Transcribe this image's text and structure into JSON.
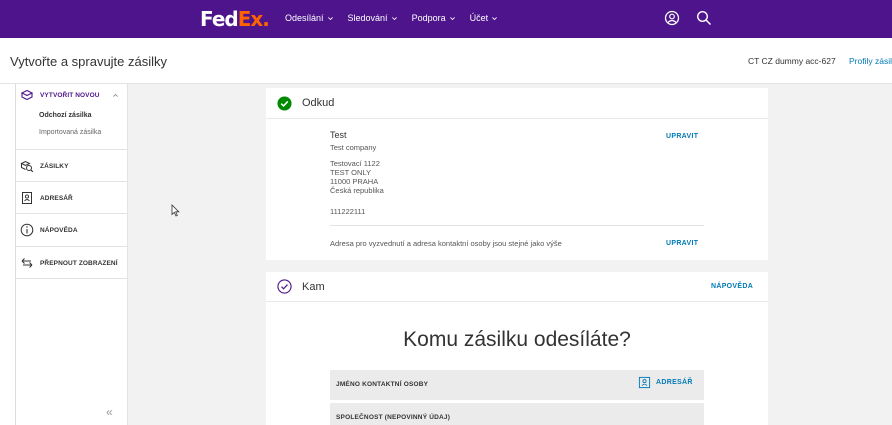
{
  "brand": {
    "logo_fed": "Fed",
    "logo_ex": "Ex.",
    "purple": "#4d148c",
    "orange": "#ff6200",
    "link_blue": "#007ab7"
  },
  "nav": {
    "items": [
      {
        "label": "Odesílání"
      },
      {
        "label": "Sledování"
      },
      {
        "label": "Podpora"
      },
      {
        "label": "Účet"
      }
    ],
    "icons": [
      "account-icon",
      "search-icon"
    ]
  },
  "header": {
    "title": "Vytvořte a spravujte zásilky",
    "account": "CT CZ dummy acc-627",
    "profiles_link": "Profily zásil"
  },
  "sidebar": {
    "create_new": "VYTVOŘIT NOVOU",
    "sub_outgoing": "Odchozí zásilka",
    "sub_imported": "Importovaná zásilka",
    "shipments": "ZÁSILKY",
    "address_book": "ADRESÁŘ",
    "help": "NÁPOVĚDA",
    "switch_view": "PŘEPNOUT ZOBRAZENÍ",
    "collapse": "«"
  },
  "from_card": {
    "title": "Odkud",
    "name": "Test",
    "company": "Test company",
    "address_lines": [
      "Testovací 1122",
      "TEST ONLY",
      "11000 PRAHA",
      "Česká republika"
    ],
    "phone": "111222111",
    "edit_label": "UPRAVIT",
    "note": "Adresa pro vyzvednutí a adresa kontaktní osoby jsou stejné jako výše",
    "edit_label_2": "UPRAVIT"
  },
  "to_card": {
    "title": "Kam",
    "help_label": "NÁPOVĚDA",
    "question": "Komu zásilku odesíláte?",
    "contact_label": "JMÉNO KONTAKTNÍ OSOBY",
    "address_book_label": "ADRESÁŘ",
    "company_label": "SPOLEČNOST (NEPOVINNÝ ÚDAJ)"
  }
}
